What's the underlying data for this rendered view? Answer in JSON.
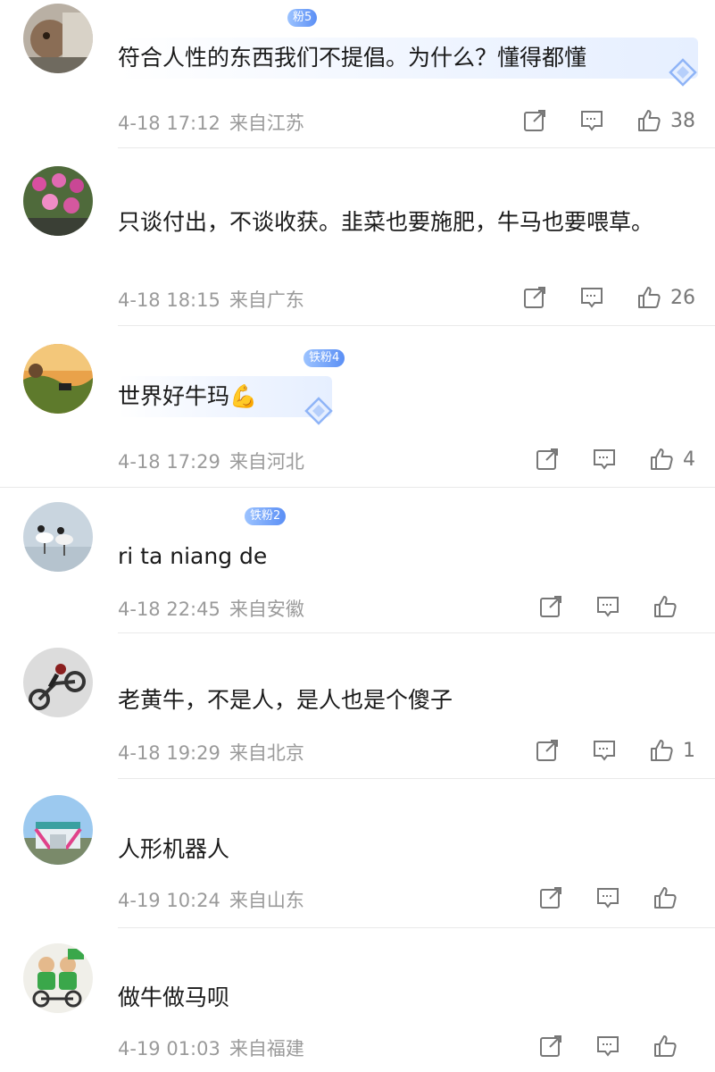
{
  "comments": [
    {
      "badge": "粉5",
      "text": "符合人性的东西我们不提倡。为什么？懂得都懂",
      "date": "4-18 17:12",
      "location": "来自江苏",
      "likes": "38"
    },
    {
      "badge": "",
      "text": "只谈付出，不谈收获。韭菜也要施肥，牛马也要喂草。",
      "date": "4-18 18:15",
      "location": "来自广东",
      "likes": "26"
    },
    {
      "badge": "铁粉4",
      "text": "世界好牛玛💪",
      "date": "4-18 17:29",
      "location": "来自河北",
      "likes": "4"
    },
    {
      "badge": "铁粉2",
      "text": "ri ta niang de",
      "date": "4-18 22:45",
      "location": "来自安徽",
      "likes": ""
    },
    {
      "badge": "",
      "text": "老黄牛，不是人，是人也是个傻子",
      "date": "4-18 19:29",
      "location": "来自北京",
      "likes": "1"
    },
    {
      "badge": "",
      "text": "人形机器人",
      "date": "4-19 10:24",
      "location": "来自山东",
      "likes": ""
    },
    {
      "badge": "",
      "text": "做牛做马呗",
      "date": "4-19 01:03",
      "location": "来自福建",
      "likes": ""
    }
  ],
  "colors": {
    "accent": "#5b8ff5",
    "meta": "#9a9a9a",
    "divider": "#e9e9e9"
  },
  "icons": [
    "share-icon",
    "reply-icon",
    "like-icon",
    "diamond-badge-icon"
  ]
}
